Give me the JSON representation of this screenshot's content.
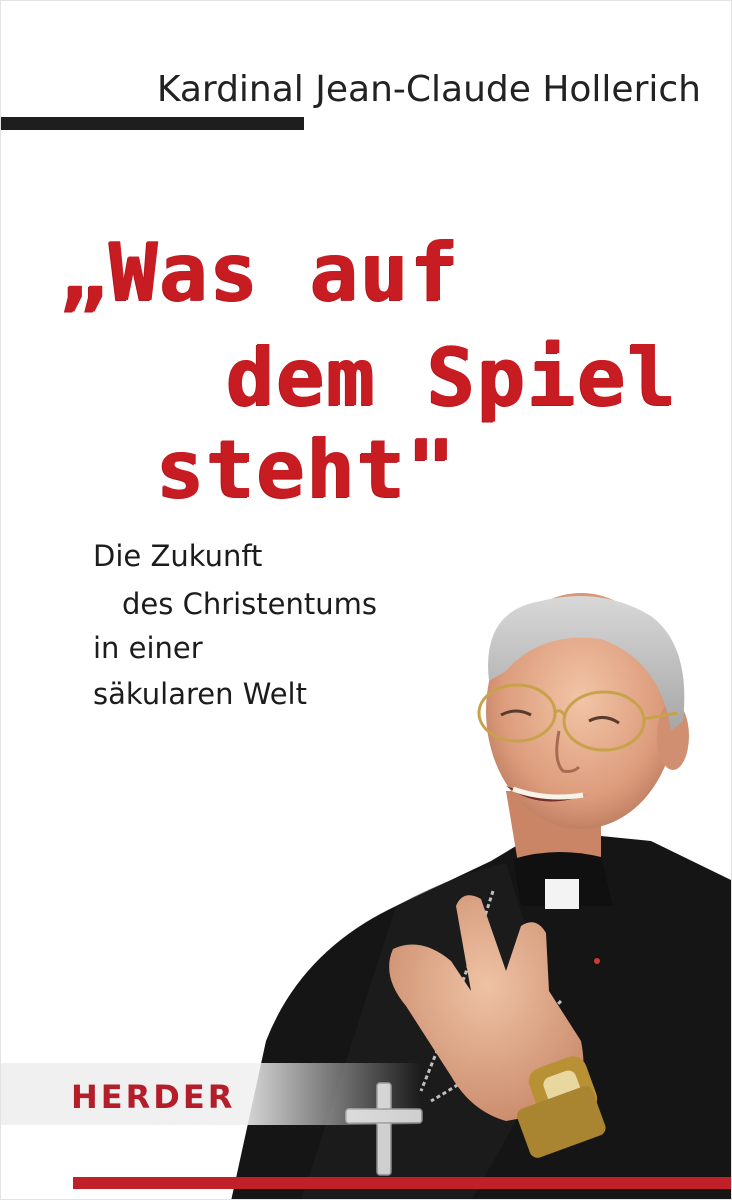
{
  "cover": {
    "author": "Kardinal Jean-Claude Hollerich",
    "title_lines": [
      "„Was auf",
      "dem Spiel",
      "steht\""
    ],
    "subtitle_lines": [
      "Die Zukunft",
      "des Christentums",
      "in einer",
      "säkularen Welt"
    ],
    "publisher": "HERDER"
  },
  "colors": {
    "title_red": "#c71c22",
    "publisher_red": "#b41e2a",
    "rule_dark": "#1e1e1e",
    "bottom_rule_red": "#c0202a",
    "band_grey": "#f0f0f0"
  }
}
